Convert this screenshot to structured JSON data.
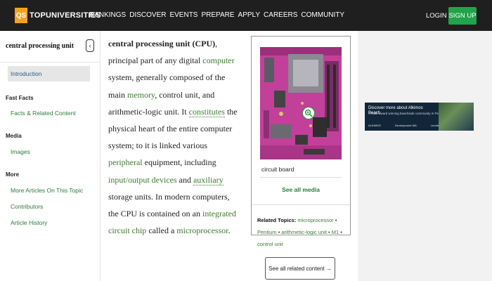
{
  "header": {
    "logo_badge": "QS",
    "logo_text": "TOPUNIVERSITIES",
    "nav": [
      "RANKINGS",
      "DISCOVER",
      "EVENTS",
      "PREPARE",
      "APPLY",
      "CAREERS",
      "COMMUNITY"
    ],
    "login": "LOGIN",
    "signup": "SIGN UP"
  },
  "sidebar": {
    "title": "central processing unit",
    "collapse_icon": "chevron-left-icon",
    "active_item": "Introduction",
    "sections": [
      {
        "heading": "Fast Facts",
        "links": [
          "Facts & Related Content"
        ]
      },
      {
        "heading": "Media",
        "links": [
          "Images"
        ]
      },
      {
        "heading": "More",
        "links": [
          "More Articles On This Topic",
          "Contributors",
          "Article History"
        ]
      }
    ]
  },
  "article": {
    "term": "central processing unit (CPU)",
    "t1": ", principal part of any digital ",
    "l1": "computer",
    "t2": " system, generally composed of the main ",
    "l2": "memory",
    "t3": ", control unit, and arithmetic-logic unit. It ",
    "l3": "constitutes",
    "t4": " the physical heart of the entire computer system; to it is linked various ",
    "l4": "peripheral",
    "t5": " equipment, including ",
    "l5": "input/output devices",
    "t6": " and ",
    "l6": "auxiliary",
    "t7": " storage units. In modern computers, the CPU is contained on an ",
    "l7": "integrated circuit chip",
    "t8": " called a ",
    "l8": "microprocessor",
    "t9": "."
  },
  "media": {
    "caption": "circuit board",
    "see_all": "See all media",
    "zoom_icon": "zoom-in-icon"
  },
  "related": {
    "label": "Related Topics:",
    "topics": [
      "microprocessor",
      "Pentium",
      "arithmetic-logic unit",
      "M1",
      "control unit"
    ],
    "see_all": "See all related content →"
  },
  "ad": {
    "headline": "Discover more about Alkimos Beach",
    "sub": "A multi-award winning beachside community in Perth",
    "brands": [
      "ALKIMOS",
      "Development WA",
      "Lendlease"
    ]
  },
  "colors": {
    "header_bg": "#1f1f1f",
    "brand_orange": "#f7a21b",
    "signup_green": "#21a34a",
    "link_green": "#3d7a30"
  }
}
